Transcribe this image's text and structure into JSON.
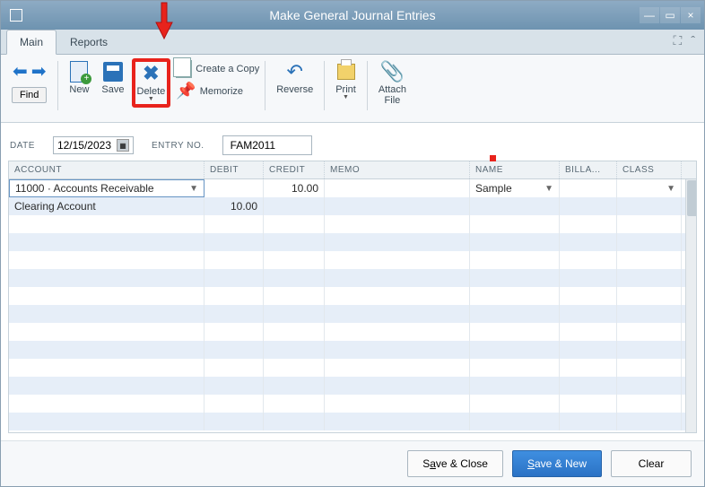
{
  "window": {
    "title": "Make General Journal Entries"
  },
  "tabs": {
    "main": "Main",
    "reports": "Reports"
  },
  "toolbar": {
    "find": "Find",
    "new": "New",
    "save": "Save",
    "delete": "Delete",
    "create_copy": "Create a Copy",
    "memorize": "Memorize",
    "reverse": "Reverse",
    "print": "Print",
    "attach_file_l1": "Attach",
    "attach_file_l2": "File"
  },
  "form": {
    "date_label": "DATE",
    "date_value": "12/15/2023",
    "entry_label": "ENTRY NO.",
    "entry_value": "FAM2011"
  },
  "grid": {
    "headers": {
      "account": "ACCOUNT",
      "debit": "DEBIT",
      "credit": "CREDIT",
      "memo": "MEMO",
      "name": "NAME",
      "billable": "BILLA...",
      "class": "CLASS"
    },
    "rows": [
      {
        "account": "11000 · Accounts Receivable",
        "debit": "",
        "credit": "10.00",
        "memo": "",
        "name": "Sample",
        "bill": "",
        "class": ""
      },
      {
        "account": "Clearing Account",
        "debit": "10.00",
        "credit": "",
        "memo": "",
        "name": "",
        "bill": "",
        "class": ""
      }
    ]
  },
  "footer": {
    "save_close": "Save & Close",
    "save_new": "Save & New",
    "clear": "Clear"
  },
  "colors": {
    "highlight": "#e8231c",
    "primary": "#2b72c5"
  }
}
